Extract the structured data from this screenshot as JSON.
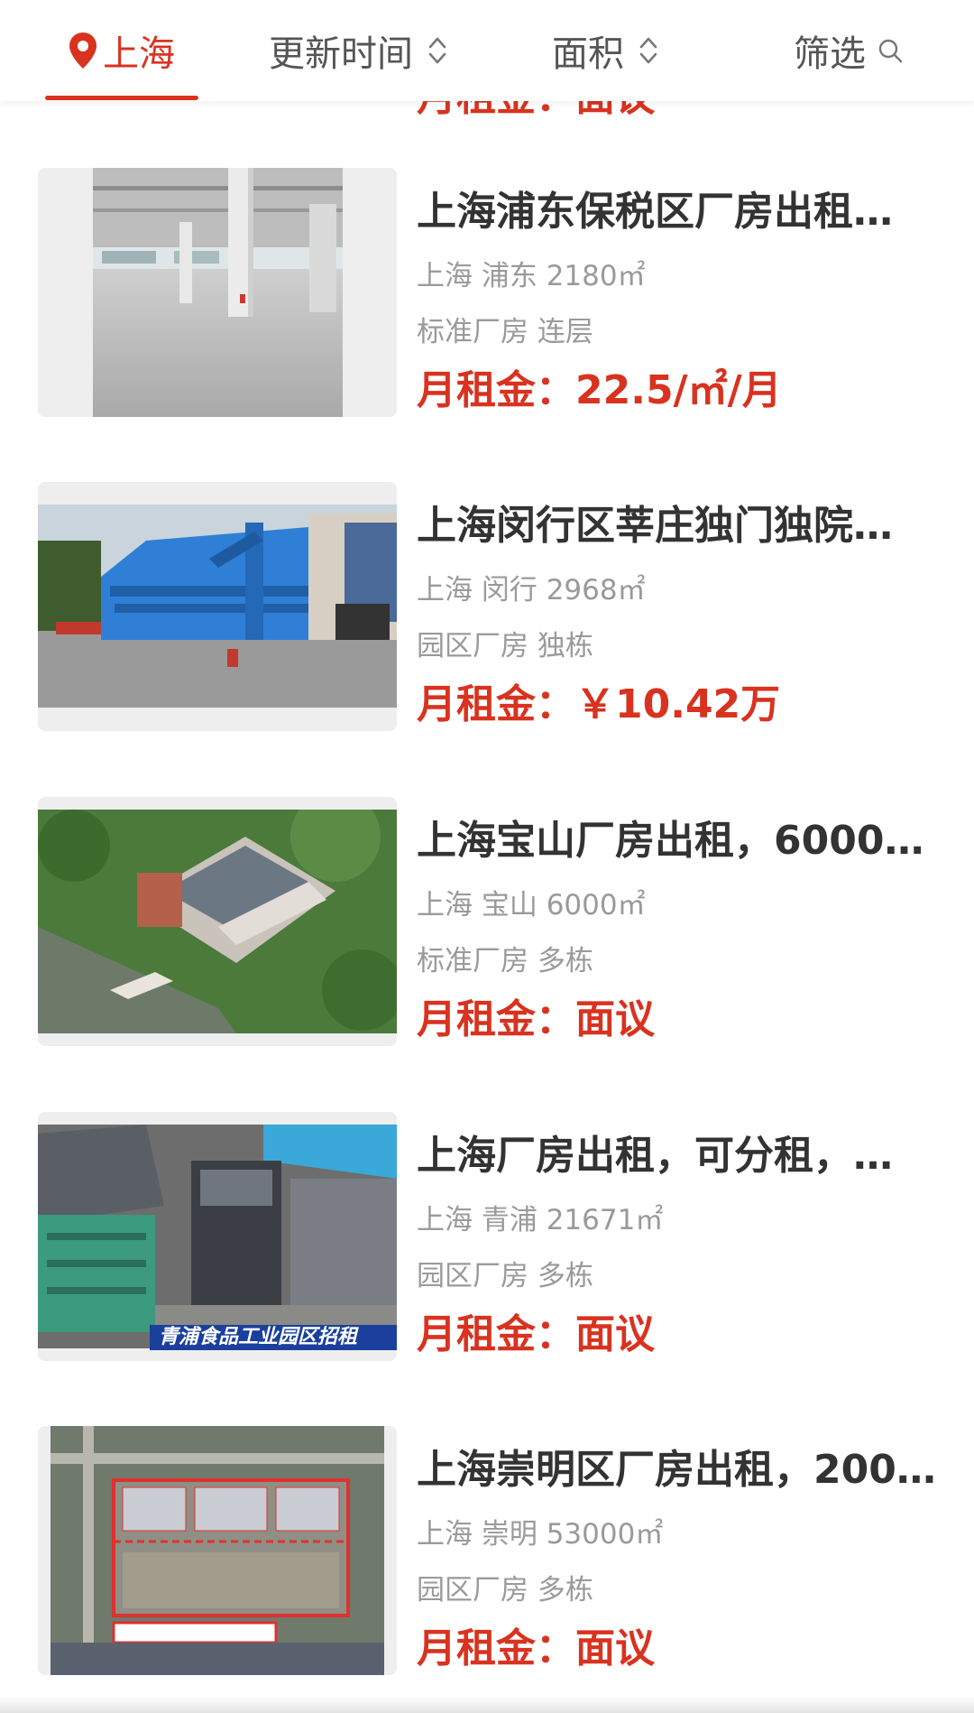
{
  "filter_bar": {
    "city": "上海",
    "update_time": "更新时间",
    "area": "面积",
    "filter": "筛选"
  },
  "previous_item": {
    "price": "月租金：面议"
  },
  "listings": [
    {
      "title": "上海浦东保税区厂房出租…",
      "location": "上海 浦东 2180㎡",
      "tags": "标准厂房 连层",
      "price": "月租金：22.5/㎡/月"
    },
    {
      "title": "上海闵行区莘庄独门独院…",
      "location": "上海 闵行 2968㎡",
      "tags": "园区厂房 独栋",
      "price": "月租金：￥10.42万"
    },
    {
      "title": "上海宝山厂房出租，6000…",
      "location": "上海 宝山 6000㎡",
      "tags": "标准厂房 多栋",
      "price": "月租金：面议"
    },
    {
      "title": "上海厂房出租，可分租，…",
      "location": "上海 青浦 21671㎡",
      "tags": "园区厂房 多栋",
      "price": "月租金：面议",
      "image_caption": "青浦食品工业园区招租"
    },
    {
      "title": "上海崇明区厂房出租，200…",
      "location": "上海 崇明 53000㎡",
      "tags": "园区厂房 多栋",
      "price": "月租金：面议"
    }
  ],
  "colors": {
    "accent": "#d9321f",
    "title_text": "#333333",
    "meta_text": "#9a9a9a"
  },
  "icons": [
    "location-pin-icon",
    "sort-chevron-icon",
    "search-icon"
  ]
}
